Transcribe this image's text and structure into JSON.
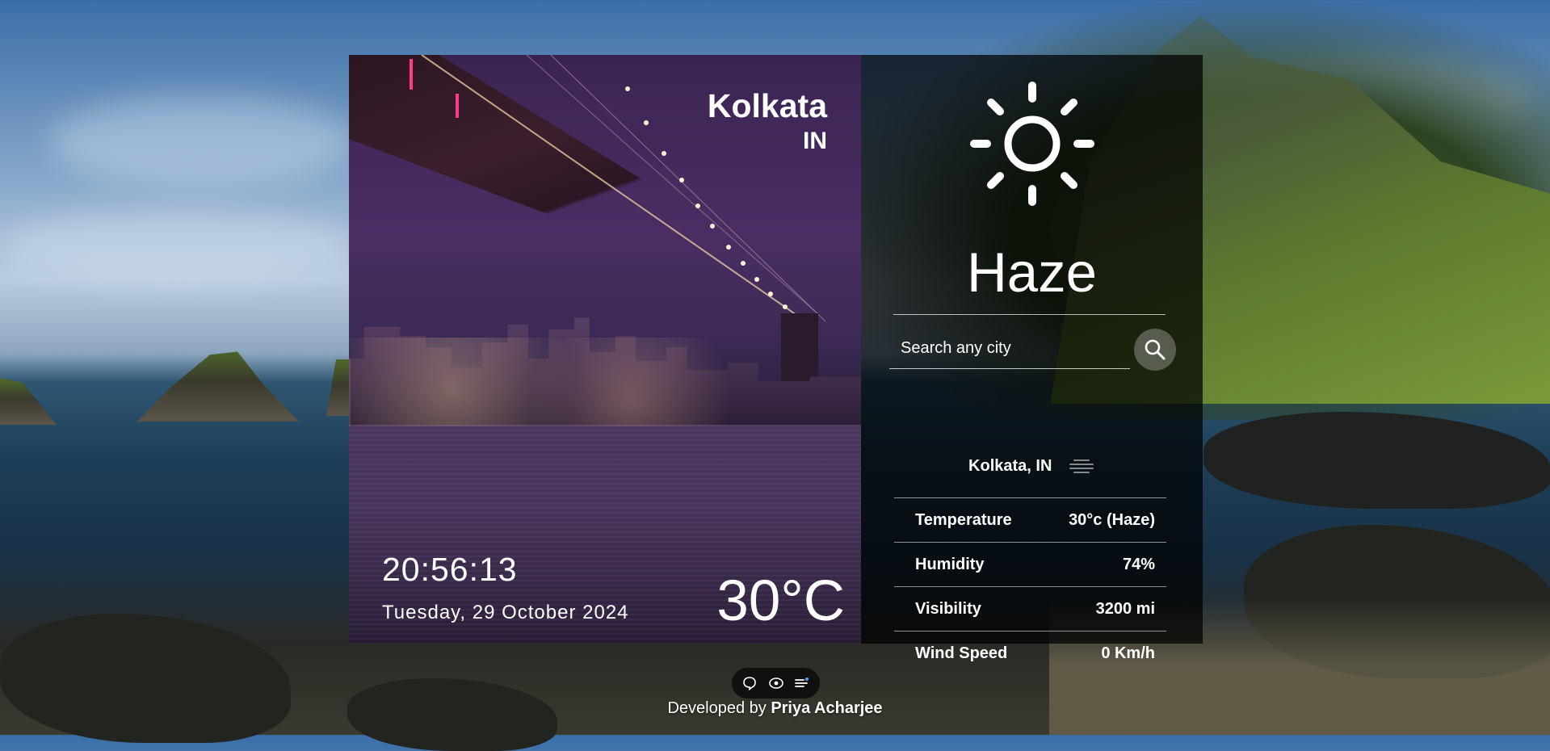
{
  "location": {
    "city": "Kolkata",
    "country": "IN",
    "full": "Kolkata, IN"
  },
  "clock": {
    "time": "20:56:13",
    "date": "Tuesday, 29 October 2024"
  },
  "current": {
    "temp_display": "30°C",
    "condition": "Haze",
    "condition_icon": "sun-icon"
  },
  "search": {
    "placeholder": "Search any city",
    "icon": "search-icon"
  },
  "details": [
    {
      "label": "Temperature",
      "value": "30°c (Haze)"
    },
    {
      "label": "Humidity",
      "value": "74%"
    },
    {
      "label": "Visibility",
      "value": "3200 mi"
    },
    {
      "label": "Wind Speed",
      "value": "0 Km/h"
    }
  ],
  "toolbar": {
    "icons": [
      "chat-icon",
      "eye-icon",
      "list-icon"
    ]
  },
  "footer": {
    "prefix": "Developed by",
    "author": "Priya Acharjee"
  }
}
